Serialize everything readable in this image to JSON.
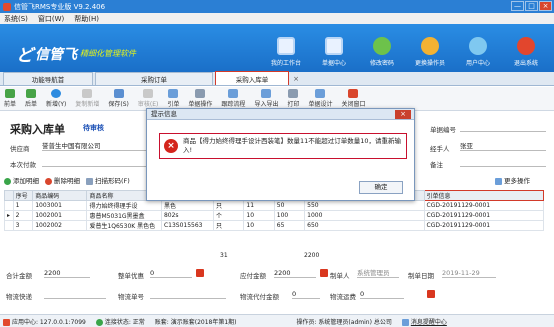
{
  "window": {
    "title": "信管飞RMS专业版 V9.2.406",
    "min": "—",
    "max": "□",
    "close": "×"
  },
  "menu": [
    "系统(S)",
    "窗口(W)",
    "帮助(H)"
  ],
  "brand": {
    "mark": "ど",
    "name": "信管飞",
    "slogan": "精细化管理软件"
  },
  "topnav": [
    {
      "label": "我的工作台",
      "icon": "monitor-icon",
      "color": "#e9f2ff"
    },
    {
      "label": "单据中心",
      "icon": "document-list-icon",
      "color": "#e9f2ff"
    },
    {
      "label": "修改密码",
      "icon": "key-icon",
      "color": "#6dc24b"
    },
    {
      "label": "更换操作员",
      "icon": "user-icon",
      "color": "#f2b233"
    },
    {
      "label": "用户中心",
      "icon": "globe-icon",
      "color": "#7fc8f0"
    },
    {
      "label": "退出系统",
      "icon": "power-icon",
      "color": "#e2462d"
    }
  ],
  "tabs": [
    "功能导航首",
    "采购订单",
    "采购入库单"
  ],
  "toolbar": [
    "前单",
    "后单",
    "新增(Y)",
    "复制新增",
    "保存(S)",
    "审核(E)",
    "引单",
    "单据操作",
    "跟踪流程",
    "导入导出",
    "打印",
    "单据设计",
    "关闭窗口"
  ],
  "form": {
    "title": "采购入库单",
    "status": "待审核",
    "supplier_label": "供应商",
    "supplier": "誉普生中国有限公司",
    "payable_label": "本次付款",
    "billno_label": "单据编号",
    "handler_label": "经手人",
    "handler": "张亚",
    "note_label": "备注"
  },
  "subtools": [
    "添加明细",
    "删除明细",
    "扫描形码(F)",
    "更多操作"
  ],
  "table": {
    "headers": [
      "序号",
      "商品编码",
      "商品名称",
      "",
      "",
      "",
      "",
      "",
      "引单信息"
    ],
    "rows": [
      [
        "1",
        "1003001",
        "得力始终得理手设",
        "黑色",
        "只",
        "11",
        "50",
        "550",
        "CGD-20191129-0001"
      ],
      [
        "2",
        "1002001",
        "惠普M5031G黑墨盒",
        "802s",
        "个",
        "10",
        "100",
        "1000",
        "CGD-20191129-0001"
      ],
      [
        "3",
        "1002002",
        "爱普生1Q6530K 黑色色",
        "C13S015563",
        "只",
        "10",
        "65",
        "650",
        "CGD-20191129-0001"
      ]
    ],
    "sum_qty": "31",
    "sum_amount": "2200"
  },
  "bottom": {
    "total_label": "合计金额",
    "total": "2200",
    "discount_label": "整单优惠",
    "discount": "0",
    "payable_label": "应付金额",
    "payable": "2200",
    "maker_label": "制单人",
    "maker": "系统管理员",
    "date_label": "制单日期",
    "date": "2019-11-29",
    "ship_label": "物流快递",
    "trackno_label": "物流单号",
    "cod_label": "物流代付金额",
    "cod": "0",
    "freight_label": "物流运费",
    "freight": "0"
  },
  "statusbar": [
    "应用中心: 127.0.0.1:7099",
    "连接状态: 正常",
    "账套: 演示账套(2018年第1期)",
    "操作员: 系统管理员(admin) 总公司",
    "消息提醒中心"
  ],
  "dialog": {
    "title": "提示信息",
    "message": "商品【得力始终得理手设计西装笔】数量11不能超过订单数量10，请重新输入!",
    "ok": "确定",
    "close": "×"
  }
}
